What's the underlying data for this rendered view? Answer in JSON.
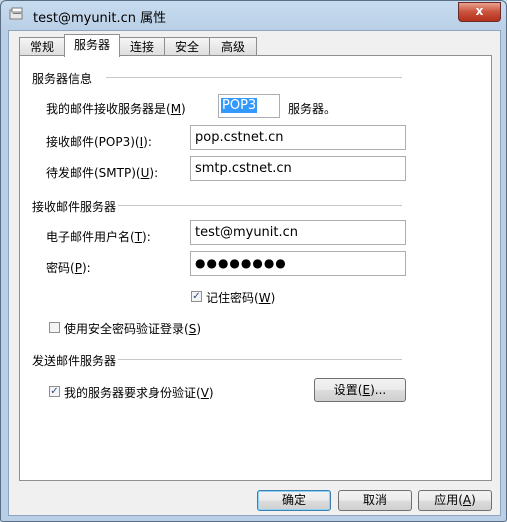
{
  "window": {
    "title": "test@myunit.cn 属性",
    "close": "x"
  },
  "tabs": [
    "常规",
    "服务器",
    "连接",
    "安全",
    "高级"
  ],
  "server_info": {
    "heading": "服务器信息",
    "incoming_type_label_pre": "我的邮件接收服务器是(",
    "incoming_type_key": "M",
    "incoming_type_label_post": ")",
    "incoming_type_value": "POP3",
    "incoming_type_suffix": "服务器。",
    "incoming_label_pre": "接收邮件(POP3)(",
    "incoming_key": "I",
    "incoming_label_post": "):",
    "incoming_value": "pop.cstnet.cn",
    "outgoing_label_pre": "待发邮件(SMTP)(",
    "outgoing_key": "U",
    "outgoing_label_post": "):",
    "outgoing_value": "smtp.cstnet.cn"
  },
  "incoming_server": {
    "heading": "接收邮件服务器",
    "username_label_pre": "电子邮件用户名(",
    "username_key": "T",
    "username_label_post": "):",
    "username_value": "test@myunit.cn",
    "password_label_pre": "密码(",
    "password_key": "P",
    "password_label_post": "):",
    "password_value": "●●●●●●●●",
    "remember_label_pre": "记住密码(",
    "remember_key": "W",
    "remember_label_post": ")",
    "remember_checked": "✓",
    "spa_label_pre": "使用安全密码验证登录(",
    "spa_key": "S",
    "spa_label_post": ")"
  },
  "outgoing_server": {
    "heading": "发送邮件服务器",
    "auth_label_pre": "我的服务器要求身份验证(",
    "auth_key": "V",
    "auth_label_post": ")",
    "auth_checked": "✓",
    "settings_pre": "设置(",
    "settings_key": "E",
    "settings_post": ")..."
  },
  "buttons": {
    "ok": "确定",
    "cancel": "取消",
    "apply_pre": "应用(",
    "apply_key": "A",
    "apply_post": ")"
  }
}
